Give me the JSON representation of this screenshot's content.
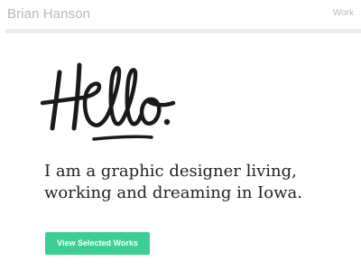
{
  "header": {
    "brand": "Brian Hanson",
    "nav_link": "Work"
  },
  "hero": {
    "lettering": "Hello.",
    "intro_lines": [
      "I am a graphic designer living,",
      "working and dreaming in Iowa."
    ],
    "cta_label": "View Selected Works"
  },
  "colors": {
    "header_text": "#b8b8b8",
    "divider": "#ececec",
    "body_text": "#222222",
    "cta_background": "#3ccf95",
    "cta_text": "#ffffff"
  }
}
